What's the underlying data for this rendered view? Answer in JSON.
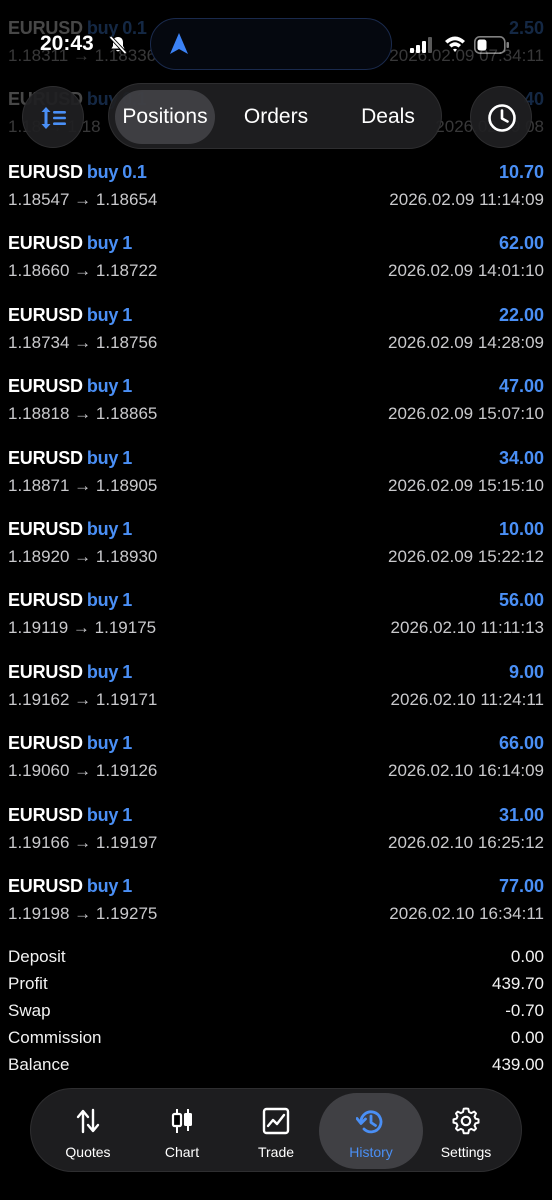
{
  "status_bar": {
    "time": "20:43"
  },
  "tabs": {
    "positions": "Positions",
    "orders": "Orders",
    "deals": "Deals",
    "active": "Positions"
  },
  "trades": [
    {
      "symbol": "EURUSD",
      "side": "buy",
      "volume": "0.1",
      "open": "1.18311",
      "close": "1.18336",
      "time": "2026.02.09 07:34:11",
      "profit": "2.50"
    },
    {
      "symbol": "EURUSD",
      "side": "buy",
      "volume": "0.1",
      "open": "1.18",
      "close": "1.18",
      "time": "2026.02.09 08",
      "profit": "40"
    },
    {
      "symbol": "EURUSD",
      "side": "buy",
      "volume": "0.1",
      "open": "1.18547",
      "close": "1.18654",
      "time": "2026.02.09 11:14:09",
      "profit": "10.70"
    },
    {
      "symbol": "EURUSD",
      "side": "buy",
      "volume": "1",
      "open": "1.18660",
      "close": "1.18722",
      "time": "2026.02.09 14:01:10",
      "profit": "62.00"
    },
    {
      "symbol": "EURUSD",
      "side": "buy",
      "volume": "1",
      "open": "1.18734",
      "close": "1.18756",
      "time": "2026.02.09 14:28:09",
      "profit": "22.00"
    },
    {
      "symbol": "EURUSD",
      "side": "buy",
      "volume": "1",
      "open": "1.18818",
      "close": "1.18865",
      "time": "2026.02.09 15:07:10",
      "profit": "47.00"
    },
    {
      "symbol": "EURUSD",
      "side": "buy",
      "volume": "1",
      "open": "1.18871",
      "close": "1.18905",
      "time": "2026.02.09 15:15:10",
      "profit": "34.00"
    },
    {
      "symbol": "EURUSD",
      "side": "buy",
      "volume": "1",
      "open": "1.18920",
      "close": "1.18930",
      "time": "2026.02.09 15:22:12",
      "profit": "10.00"
    },
    {
      "symbol": "EURUSD",
      "side": "buy",
      "volume": "1",
      "open": "1.19119",
      "close": "1.19175",
      "time": "2026.02.10 11:11:13",
      "profit": "56.00"
    },
    {
      "symbol": "EURUSD",
      "side": "buy",
      "volume": "1",
      "open": "1.19162",
      "close": "1.19171",
      "time": "2026.02.10 11:24:11",
      "profit": "9.00"
    },
    {
      "symbol": "EURUSD",
      "side": "buy",
      "volume": "1",
      "open": "1.19060",
      "close": "1.19126",
      "time": "2026.02.10 16:14:09",
      "profit": "66.00"
    },
    {
      "symbol": "EURUSD",
      "side": "buy",
      "volume": "1",
      "open": "1.19166",
      "close": "1.19197",
      "time": "2026.02.10 16:25:12",
      "profit": "31.00"
    },
    {
      "symbol": "EURUSD",
      "side": "buy",
      "volume": "1",
      "open": "1.19198",
      "close": "1.19275",
      "time": "2026.02.10 16:34:11",
      "profit": "77.00"
    }
  ],
  "summary": [
    {
      "label": "Deposit",
      "value": "0.00"
    },
    {
      "label": "Profit",
      "value": "439.70"
    },
    {
      "label": "Swap",
      "value": "-0.70"
    },
    {
      "label": "Commission",
      "value": "0.00"
    },
    {
      "label": "Balance",
      "value": "439.00"
    }
  ],
  "bottom_nav": [
    {
      "label": "Quotes",
      "icon": "quotes-icon"
    },
    {
      "label": "Chart",
      "icon": "candlestick-icon"
    },
    {
      "label": "Trade",
      "icon": "trade-chart-icon"
    },
    {
      "label": "History",
      "icon": "history-icon",
      "active": true
    },
    {
      "label": "Settings",
      "icon": "gear-icon"
    }
  ],
  "colors": {
    "accent": "#4a8ff5",
    "background": "#000000",
    "text": "#ffffff",
    "muted": "#c9c9cc"
  }
}
